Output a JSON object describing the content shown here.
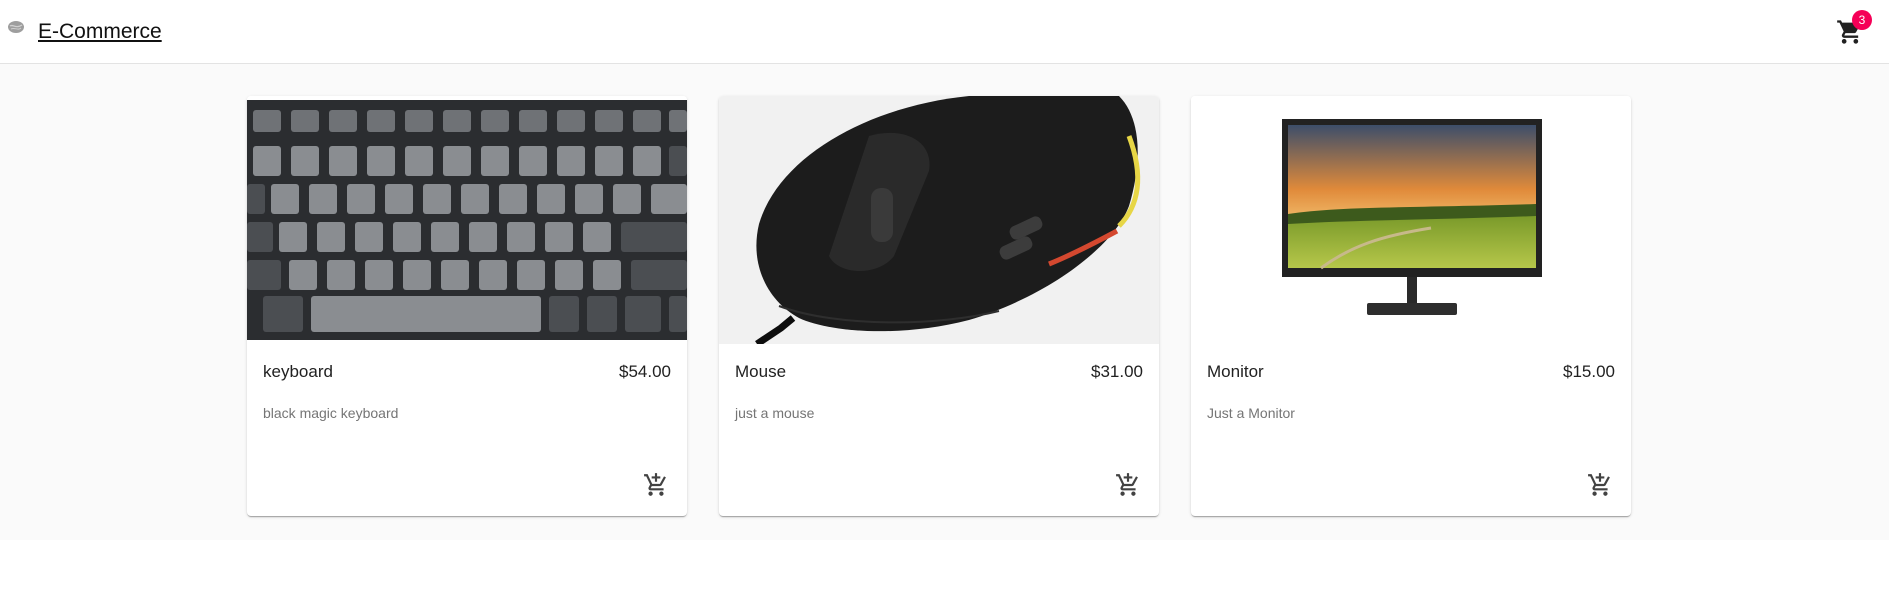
{
  "header": {
    "brand": "E-Commerce",
    "logo_icon": "globe-logo-icon",
    "cart_icon": "shopping-cart-icon",
    "cart_count": "3",
    "badge_color": "#f50057"
  },
  "products": [
    {
      "name": "keyboard",
      "price": "$54.00",
      "description": "black magic keyboard",
      "image": "keyboard-photo",
      "action_icon": "add-shopping-cart-icon"
    },
    {
      "name": "Mouse",
      "price": "$31.00",
      "description": "just a mouse",
      "image": "mouse-photo",
      "action_icon": "add-shopping-cart-icon"
    },
    {
      "name": "Monitor",
      "price": "$15.00",
      "description": "Just a Monitor",
      "image": "monitor-photo",
      "action_icon": "add-shopping-cart-icon"
    }
  ]
}
